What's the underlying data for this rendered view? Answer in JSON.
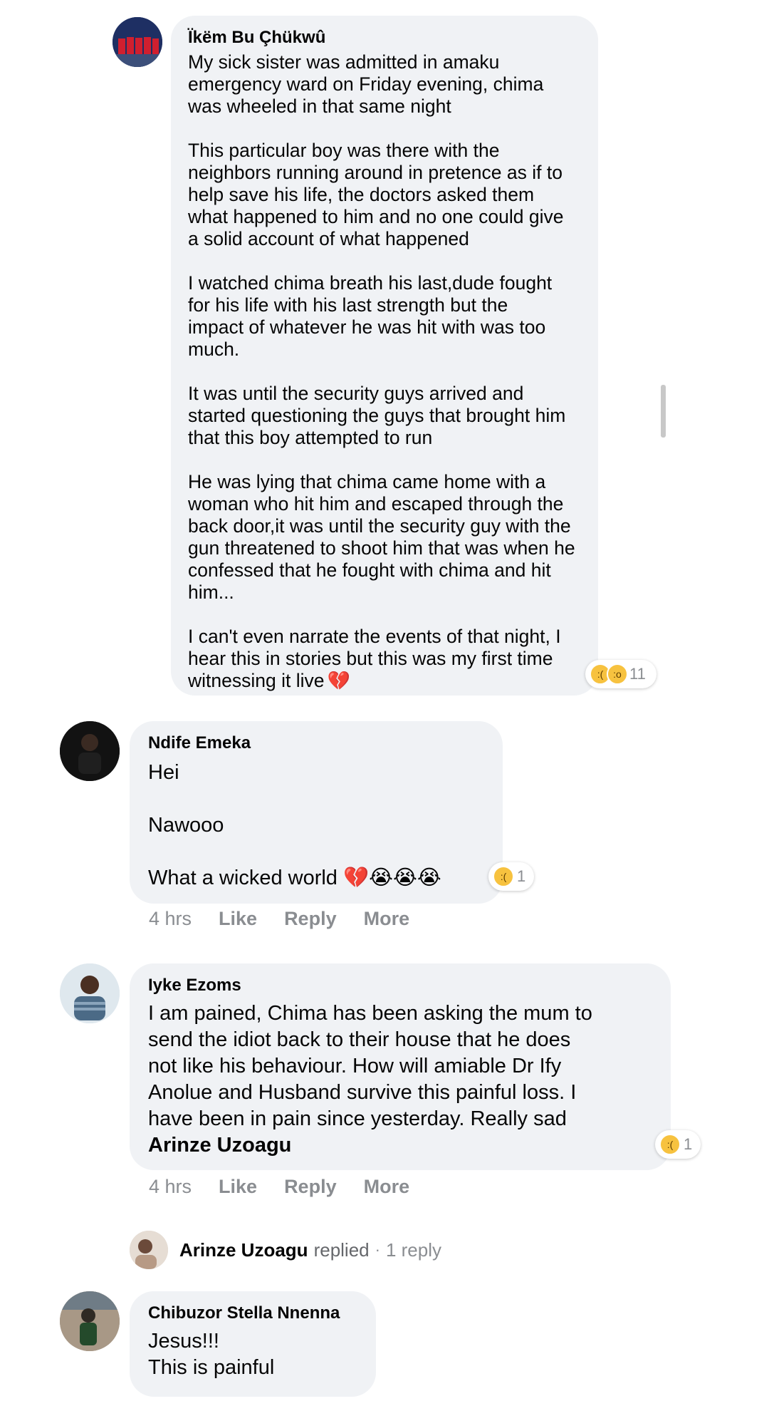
{
  "comments": [
    {
      "author": "Ïkëm Bu Çhükwû",
      "text": "My sick sister was admitted in amaku\nemergency ward on Friday evening, chima\nwas wheeled in that same night\n\nThis particular boy was there with the\nneighbors running around in pretence as if to\nhelp save his life, the doctors asked them\nwhat happened to him and no one could give\na solid account of what happened\n\nI watched chima breath his last,dude fought\nfor his life with his last strength but the\nimpact of whatever he was hit with was too\nmuch.\n\nIt was until the security guys arrived and\nstarted questioning the guys that brought him\nthat this boy attempted to run\n\nHe was lying that chima came home with a\nwoman who hit him and escaped through the\nback door,it was until the security guy with the\ngun threatened to shoot him that was when he\nconfessed that he fought with chima and hit\nhim...\n\nI can't even narrate the events of that night, I\nhear this in stories but this was my first time\nwitnessing it live",
      "trailing_emoji": "💔",
      "reaction_count": "11",
      "reaction_icons": [
        "sad-reaction-icon",
        "wow-reaction-icon"
      ]
    },
    {
      "author": "Ndife Emeka",
      "text": "Hei\n\nNawooo\n\nWhat a wicked world",
      "trailing_emoji": "💔😭😭😭",
      "reaction_count": "1",
      "reaction_icons": [
        "sad-reaction-icon"
      ],
      "time": "4 hrs",
      "like": "Like",
      "reply": "Reply",
      "more": "More"
    },
    {
      "author": "Iyke Ezoms",
      "text": "I am pained, Chima has been asking the mum to\nsend the idiot back to their house that he does\nnot like his behaviour. How will amiable Dr Ify\nAnolue and Husband survive this painful loss. I\nhave been in pain since yesterday. Really sad",
      "mention": "Arinze Uzoagu",
      "reaction_count": "1",
      "reaction_icons": [
        "sad-reaction-icon"
      ],
      "time": "4 hrs",
      "like": "Like",
      "reply": "Reply",
      "more": "More"
    },
    {
      "author": "Chibuzor Stella Nnenna",
      "text": "Jesus!!!\nThis is painful"
    }
  ],
  "replies_summary": {
    "name": "Arinze Uzoagu",
    "verb": "replied",
    "separator": "·",
    "count_text": "1 reply"
  },
  "colors": {
    "bubble": "#f0f2f5",
    "meta_text": "#8a8d91",
    "reaction_yellow": "#f7c23f",
    "heart_red": "#e0245e"
  }
}
